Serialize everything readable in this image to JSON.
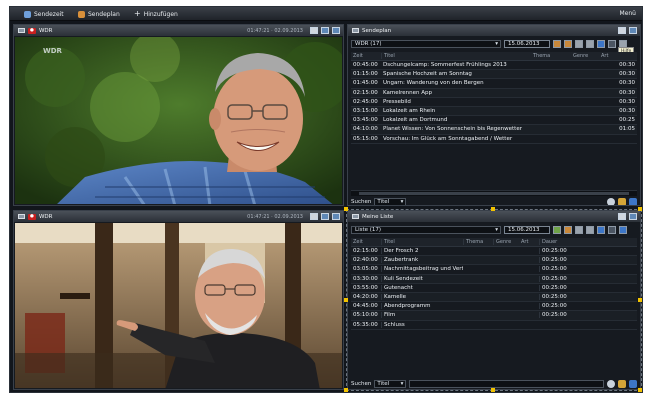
{
  "colors": {
    "background": "#12161c",
    "accent": "#3d76c7",
    "recording": "#c81f1f",
    "selection": "#f2c200"
  },
  "topbar": {
    "items": [
      {
        "label": "Sendezeit",
        "icon": "monitor-icon"
      },
      {
        "label": "Sendeplan",
        "icon": "schedule-icon"
      },
      {
        "label": "Hinzufügen",
        "icon": "plus-icon"
      }
    ],
    "close_label": "Menü"
  },
  "video_top": {
    "title": "WDR",
    "time": "01:47:21 · 02.09.2013",
    "channel_logo": "WDR"
  },
  "video_bottom": {
    "title": "WDR",
    "time": "01:47:21 · 02.09.2013"
  },
  "epg": {
    "title": "Sendeplan",
    "channel": "WDR (17)",
    "date": "15.06.2013",
    "tooltip": "Hilfe",
    "columns": [
      "Zeit",
      "Titel",
      "Thema",
      "Genre",
      "Art"
    ],
    "rows": [
      {
        "time": "00:45:00",
        "title": "Dschungelcamp: Sommerfest Frühlings 2013",
        "dur": "00:30"
      },
      {
        "time": "01:15:00",
        "title": "Spanische Hochzeit am Sonntag",
        "dur": "00:30"
      },
      {
        "time": "01:45:00",
        "title": "Ungarn: Wanderung von den Bergen",
        "dur": "00:30"
      },
      {
        "time": "02:15:00",
        "title": "Kamelrennen App",
        "dur": "00:30"
      },
      {
        "time": "02:45:00",
        "title": "Pressebild",
        "dur": "00:30"
      },
      {
        "time": "03:15:00",
        "title": "Lokalzeit am Rhein",
        "dur": "00:30"
      },
      {
        "time": "03:45:00",
        "title": "Lokalzeit am Dortmund",
        "dur": "00:25"
      },
      {
        "time": "04:10:00",
        "title": "Planet Wissen: Von Sonnenschein bis Regenwetter",
        "dur": "01:05"
      },
      {
        "time": "05:15:00",
        "title": "Vorschau: Im Glück am Sonntagabend / Wetter",
        "dur": ""
      }
    ],
    "search_label": "Suchen",
    "search_option": "Titel"
  },
  "list": {
    "title": "Meine Liste",
    "channel": "Liste (17)",
    "date": "15.06.2013",
    "columns": [
      "Zeit",
      "Titel",
      "Thema",
      "Genre",
      "Art",
      "Dauer"
    ],
    "rows": [
      {
        "time": "02:15:00",
        "title": "Der Frosch 2",
        "dur": "00:25:00"
      },
      {
        "time": "02:40:00",
        "title": "Zaubertrank",
        "dur": "00:25:00"
      },
      {
        "time": "03:05:00",
        "title": "Nachmittagsbeitrag und Verteilung",
        "dur": "00:25:00"
      },
      {
        "time": "03:30:00",
        "title": "Kuli Sendezeit",
        "dur": "00:25:00"
      },
      {
        "time": "03:55:00",
        "title": "Gutenacht",
        "dur": "00:25:00"
      },
      {
        "time": "04:20:00",
        "title": "Kamelle",
        "dur": "00:25:00"
      },
      {
        "time": "04:45:00",
        "title": "Abendprogramm",
        "dur": "00:25:00"
      },
      {
        "time": "05:10:00",
        "title": "Film",
        "dur": "00:25:00"
      },
      {
        "time": "05:35:00",
        "title": "Schluss",
        "dur": ""
      }
    ],
    "search_label": "Suchen",
    "search_option": "Titel"
  }
}
